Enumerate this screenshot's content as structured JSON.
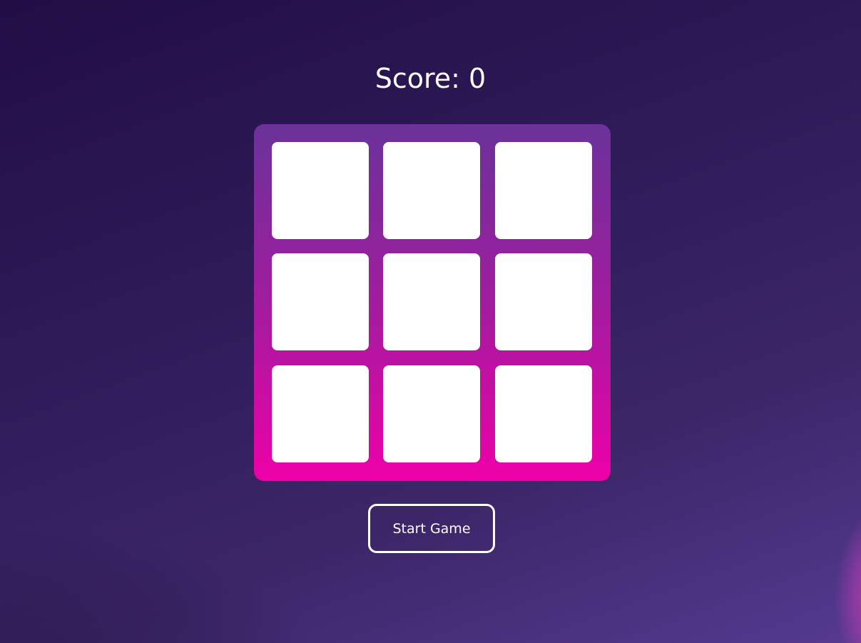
{
  "score": {
    "label": "Score: 0",
    "value": 0
  },
  "board": {
    "rows": 3,
    "cols": 3
  },
  "start_button": {
    "label": "Start Game"
  },
  "colors": {
    "board_top": "#6a329a",
    "board_bottom": "#ee00a8",
    "tile": "#ffffff"
  }
}
